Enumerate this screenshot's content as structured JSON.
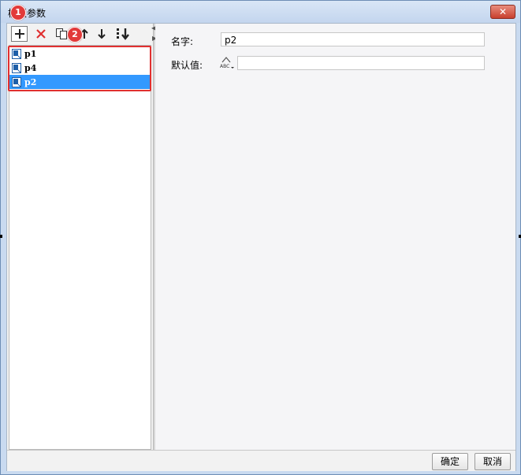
{
  "window": {
    "title": "模板参数"
  },
  "toolbar": {
    "add": "add-icon",
    "delete": "delete-icon",
    "copy": "copy-icon",
    "up": "arrow-up-icon",
    "down": "arrow-down-icon",
    "sort": "sort-icon"
  },
  "params": [
    {
      "name": "p1",
      "selected": false
    },
    {
      "name": "p4",
      "selected": false
    },
    {
      "name": "p2",
      "selected": true
    }
  ],
  "annotations": {
    "badge1": "1",
    "badge2": "2"
  },
  "form": {
    "name_label": "名字:",
    "name_value": "p2",
    "default_label": "默认值:",
    "default_value": ""
  },
  "footer": {
    "ok": "确定",
    "cancel": "取消"
  },
  "colors": {
    "selection": "#3399ff",
    "highlight": "#e03030",
    "badge": "#e23a3a"
  }
}
